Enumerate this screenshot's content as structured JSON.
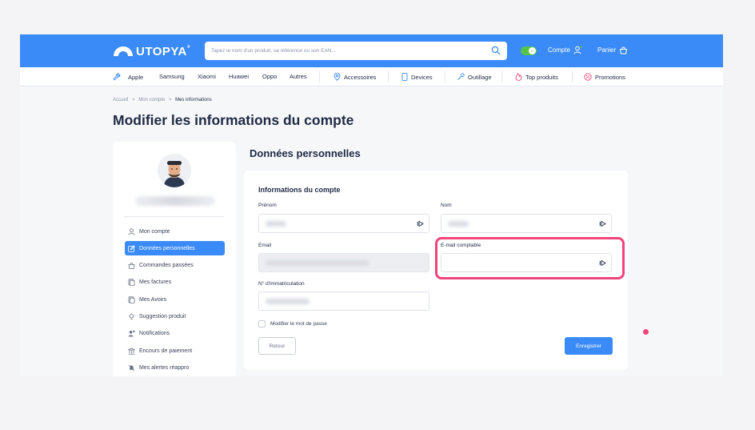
{
  "header": {
    "logo_text": "UTOPYA",
    "logo_mark": "®",
    "search_placeholder": "Tapez le nom d'un produit, sa référence ou son EAN...",
    "toggle_label": "E",
    "account_label": "Compte",
    "cart_label": "Panier"
  },
  "nav": {
    "items": [
      {
        "label": "Apple"
      },
      {
        "label": "Samsung"
      },
      {
        "label": "Xiaomi"
      },
      {
        "label": "Huawei"
      },
      {
        "label": "Oppo"
      },
      {
        "label": "Autres"
      },
      {
        "label": "Accessoires"
      },
      {
        "label": "Devices"
      },
      {
        "label": "Outillage"
      },
      {
        "label": "Top produits"
      },
      {
        "label": "Promotions"
      }
    ]
  },
  "breadcrumb": {
    "items": [
      "Accueil",
      "Mon compte",
      "Mes informations"
    ],
    "separator": ">"
  },
  "page": {
    "title": "Modifier les informations du compte",
    "section_title": "Données personnelles"
  },
  "sidebar": {
    "items": [
      {
        "label": "Mon compte",
        "active": false
      },
      {
        "label": "Données personnelles",
        "active": true
      },
      {
        "label": "Commandes passées",
        "active": false
      },
      {
        "label": "Mes factures",
        "active": false
      },
      {
        "label": "Mes Avoirs",
        "active": false
      },
      {
        "label": "Suggestion produit",
        "active": false
      },
      {
        "label": "Notifications",
        "active": false
      },
      {
        "label": "Encours de paiement",
        "active": false
      },
      {
        "label": "Mes alertes réappro",
        "active": false
      }
    ]
  },
  "form": {
    "title": "Informations du compte",
    "firstname_label": "Prénom",
    "lastname_label": "Nom",
    "email_label": "Email",
    "accounting_email_label": "E-mail comptable",
    "registration_label": "N° d'immatriculation",
    "change_password_label": "Modifier le mot de passe",
    "back_label": "Retour",
    "save_label": "Enregistrer"
  },
  "colors": {
    "brand": "#3a8bf7",
    "highlight": "#f0457a",
    "toggle": "#55c24a"
  }
}
